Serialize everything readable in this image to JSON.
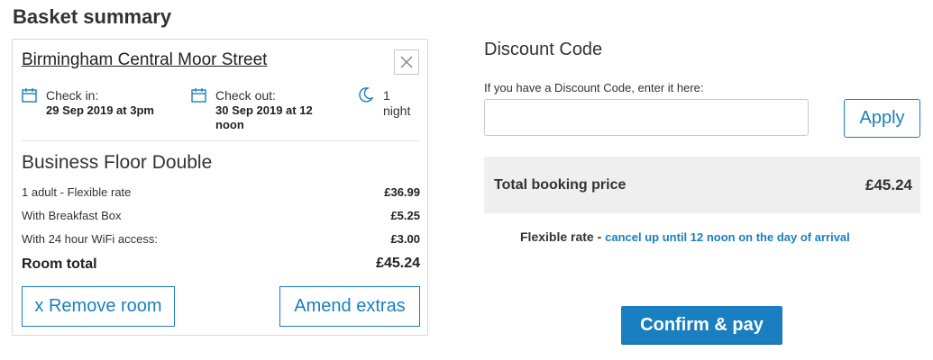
{
  "basket": {
    "title": "Basket summary",
    "hotel_name": "Birmingham Central Moor Street",
    "check_in_label": "Check in:",
    "check_in_value": "29 Sep 2019 at 3pm",
    "check_out_label": "Check out:",
    "check_out_value": "30 Sep 2019 at 12 noon",
    "nights_value": "1 night",
    "room_type": "Business Floor Double",
    "lines": [
      {
        "label": "1 adult - Flexible rate",
        "price": "£36.99"
      },
      {
        "label": "With Breakfast Box",
        "price": "£5.25"
      },
      {
        "label": "With 24 hour WiFi access:",
        "price": "£3.00"
      }
    ],
    "room_total_label": "Room total",
    "room_total_price": "£45.24",
    "remove_button": "x Remove room",
    "amend_button": "Amend extras"
  },
  "discount": {
    "title": "Discount Code",
    "hint": "If you have a Discount Code, enter it here:",
    "input_value": "",
    "apply_button": "Apply"
  },
  "summary": {
    "total_label": "Total booking price",
    "total_price": "£45.24",
    "rate_label": "Flexible rate - ",
    "rate_link": "cancel up until 12 noon on the day of arrival",
    "confirm_button": "Confirm & pay"
  },
  "colors": {
    "accent": "#1a7fc1",
    "panel_bg": "#efefef",
    "border": "#d9d9d9"
  },
  "icons": [
    "close-icon",
    "calendar-icon",
    "moon-icon"
  ]
}
